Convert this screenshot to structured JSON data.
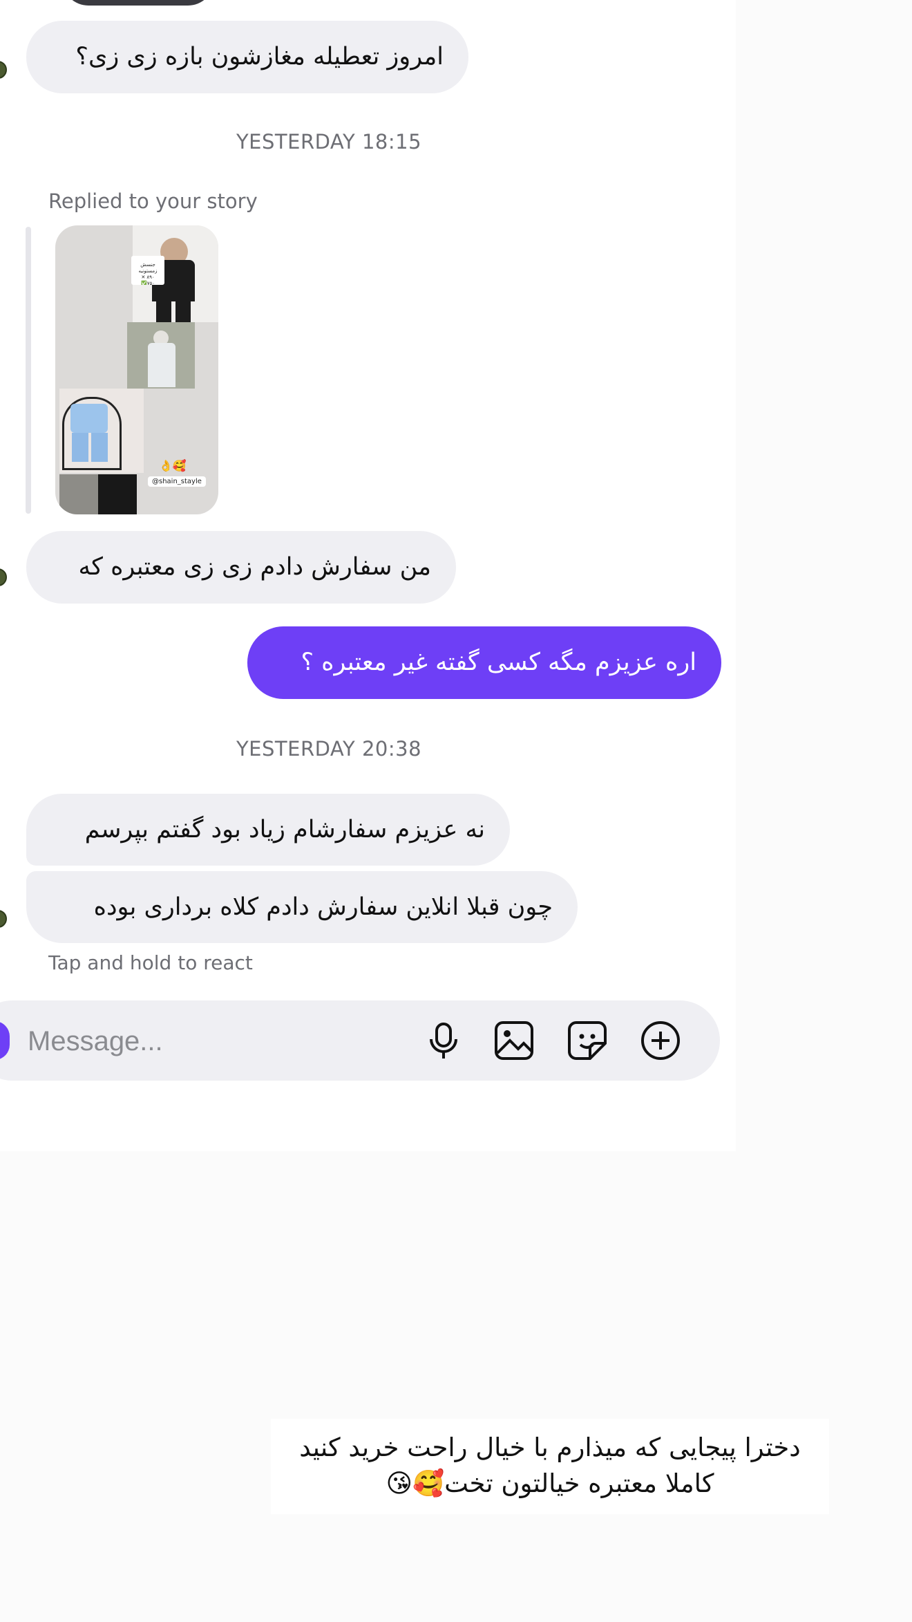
{
  "messages": [
    {
      "text": "امروز تعطیله مغازشون بازه زی زی؟",
      "sender": "them"
    },
    {
      "text": "من سفارش دادم زی زی معتبره که",
      "sender": "them"
    },
    {
      "text": "اره عزیزم مگه کسی گفته غیر معتبره ؟",
      "sender": "me"
    },
    {
      "text": "نه عزیزم سفارشام زیاد بود گفتم بپرسم",
      "sender": "them"
    },
    {
      "text": "چون قبلا انلاین سفارش دادم کلاه برداری بوده",
      "sender": "them"
    }
  ],
  "timestamps": [
    "YESTERDAY 18:15",
    "YESTERDAY 20:38"
  ],
  "story_reply_label": "Replied to your story",
  "story_preview": {
    "top_text": "جنسش زمستونیه\n۸۹۰ ✕\n۷۵۰✅",
    "handle": "@shain_stayle",
    "emoji": "👌🥰"
  },
  "react_hint": "Tap and hold to react",
  "composer": {
    "placeholder": "Message...",
    "icons": [
      "microphone-icon",
      "image-icon",
      "sticker-icon",
      "plus-circle-icon"
    ]
  },
  "caption": {
    "line1": "دخترا پیجایی که میذارم با خیال راحت خرید کنید",
    "line2": "کاملا معتبره خیالتون تخت🥰😘"
  },
  "colors": {
    "accent": "#6e3ff6",
    "bubble_them": "#efeff3",
    "timestamp": "#6d6e74"
  }
}
